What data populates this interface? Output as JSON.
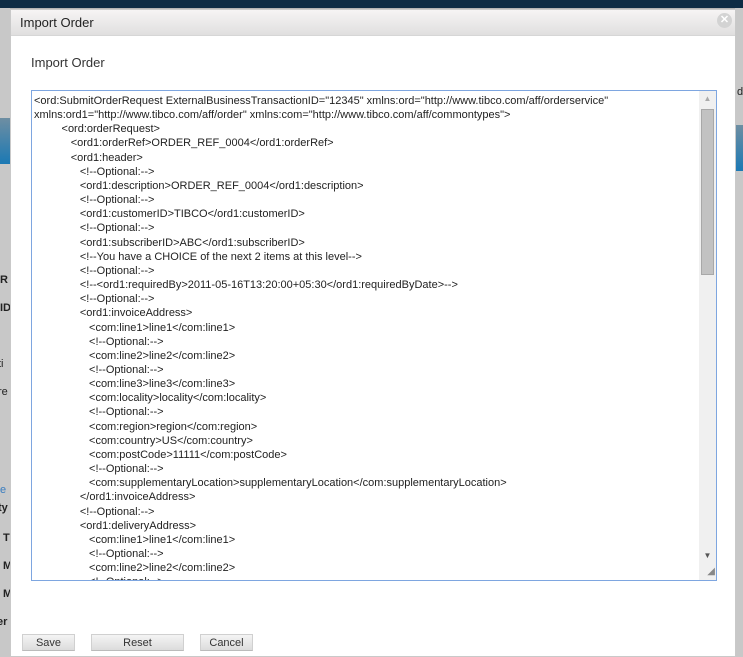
{
  "background": {
    "fragments_left": [
      "R",
      "ID",
      "ti",
      "re",
      "e",
      "ty",
      "T",
      "M",
      "M",
      "er"
    ],
    "fragment_right": "d"
  },
  "dialog": {
    "title": "Import Order",
    "close_icon": "close-icon",
    "heading": "Import Order",
    "xml_value": "<ord:SubmitOrderRequest ExternalBusinessTransactionID=\"12345\" xmlns:ord=\"http://www.tibco.com/aff/orderservice\" xmlns:ord1=\"http://www.tibco.com/aff/order\" xmlns:com=\"http://www.tibco.com/aff/commontypes\">\n         <ord:orderRequest>\n            <ord1:orderRef>ORDER_REF_0004</ord1:orderRef>\n            <ord1:header>\n               <!--Optional:-->\n               <ord1:description>ORDER_REF_0004</ord1:description>\n               <!--Optional:-->\n               <ord1:customerID>TIBCO</ord1:customerID>\n               <!--Optional:-->\n               <ord1:subscriberID>ABC</ord1:subscriberID>\n               <!--You have a CHOICE of the next 2 items at this level-->\n               <!--Optional:-->\n               <!--<ord1:requiredBy>2011-05-16T13:20:00+05:30</ord1:requiredByDate>-->\n               <!--Optional:-->\n               <ord1:invoiceAddress>\n                  <com:line1>line1</com:line1>\n                  <!--Optional:-->\n                  <com:line2>line2</com:line2>\n                  <!--Optional:-->\n                  <com:line3>line3</com:line3>\n                  <com:locality>locality</com:locality>\n                  <!--Optional:-->\n                  <com:region>region</com:region>\n                  <com:country>US</com:country>\n                  <com:postCode>11111</com:postCode>\n                  <!--Optional:-->\n                  <com:supplementaryLocation>supplementaryLocation</com:supplementaryLocation>\n               </ord1:invoiceAddress>\n               <!--Optional:-->\n               <ord1:deliveryAddress>\n                  <com:line1>line1</com:line1>\n                  <!--Optional:-->\n                  <com:line2>line2</com:line2>\n                  <!--Optional:-->",
    "buttons": {
      "save": "Save",
      "reset": "Reset",
      "cancel": "Cancel"
    }
  }
}
